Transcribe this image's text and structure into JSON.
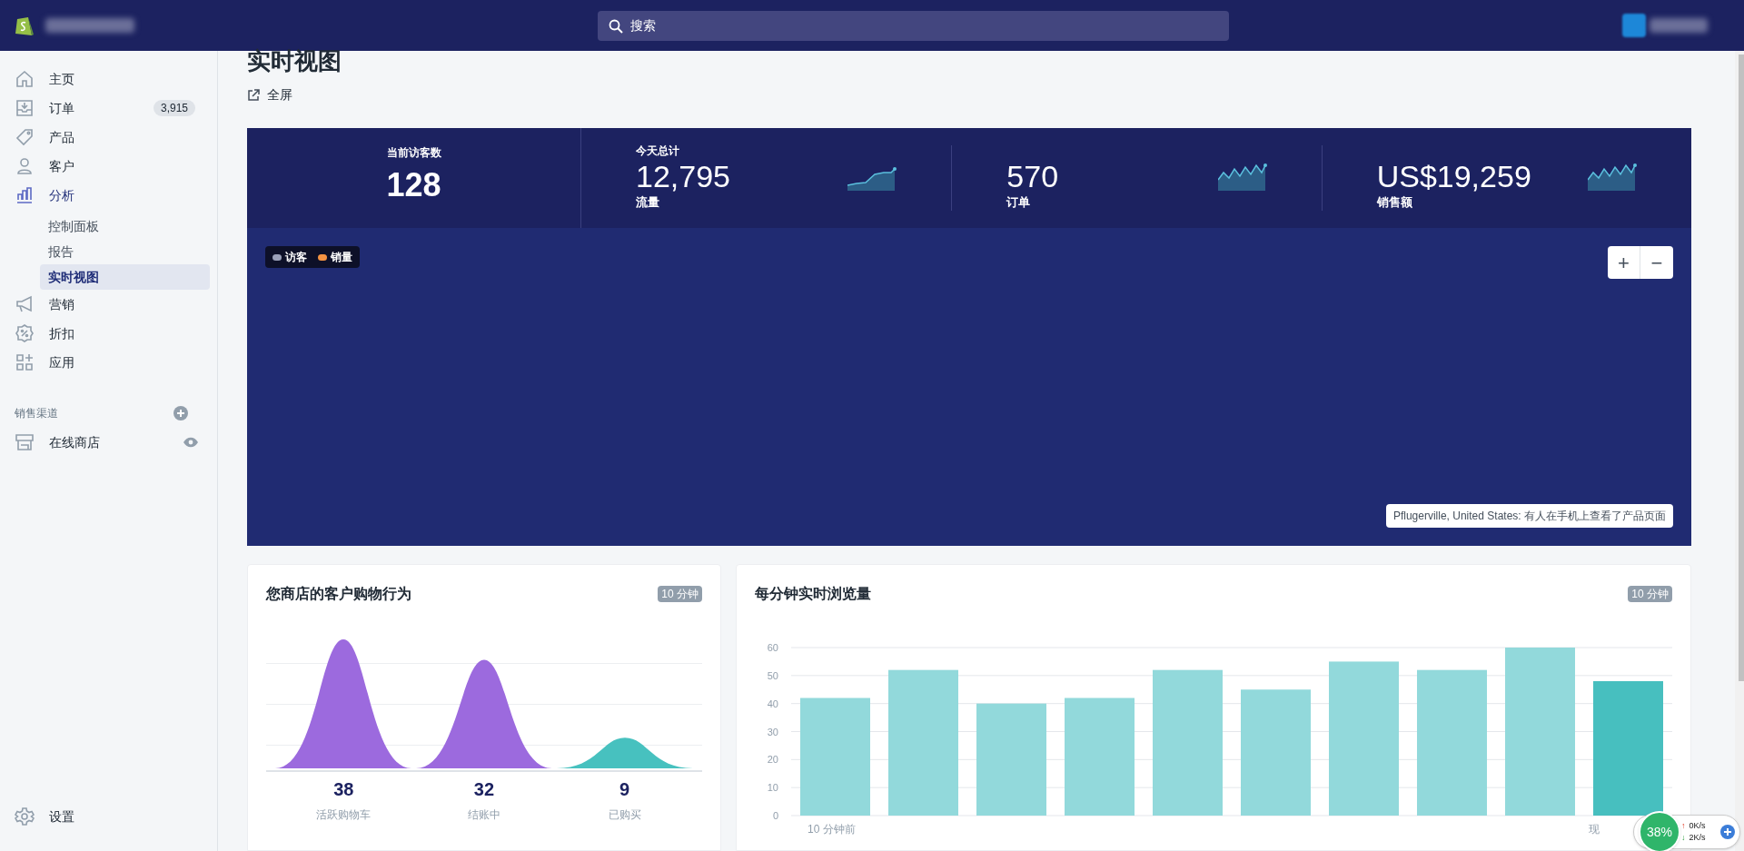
{
  "topbar": {
    "search": {
      "placeholder": "搜索"
    }
  },
  "sidebar": {
    "items": [
      {
        "kind": "home",
        "label": "主页",
        "selected": false
      },
      {
        "kind": "orders",
        "label": "订单",
        "badge": "3,915",
        "selected": false
      },
      {
        "kind": "products",
        "label": "产品",
        "selected": false
      },
      {
        "kind": "customers",
        "label": "客户",
        "selected": false
      },
      {
        "kind": "analytics",
        "label": "分析",
        "selected": true,
        "children": [
          {
            "label": "控制面板",
            "selected": false
          },
          {
            "label": "报告",
            "selected": false
          },
          {
            "label": "实时视图",
            "selected": true
          }
        ]
      },
      {
        "kind": "marketing",
        "label": "营销",
        "selected": false
      },
      {
        "kind": "discounts",
        "label": "折扣",
        "selected": false
      },
      {
        "kind": "apps",
        "label": "应用",
        "selected": false
      }
    ],
    "section_title": "销售渠道",
    "channels": [
      {
        "label": "在线商店"
      }
    ],
    "settings": "设置"
  },
  "page": {
    "title": "实时视图",
    "fullscreen": "全屏"
  },
  "stats": {
    "visitors": {
      "label": "当前访客数",
      "value": "128"
    },
    "group_title": "今天总计",
    "totals": [
      {
        "value": "12,795",
        "label": "流量"
      },
      {
        "value": "570",
        "label": "订单"
      },
      {
        "value": "US$19,259",
        "label": "销售额"
      }
    ]
  },
  "map": {
    "legend": [
      {
        "label": "访客",
        "color": "#9aa0b8"
      },
      {
        "label": "销量",
        "color": "#f49342"
      }
    ],
    "zoom_in": "+",
    "zoom_out": "−",
    "event": "Pflugerville, United States: 有人在手机上查看了产品页面"
  },
  "behavior": {
    "title": "您商店的客户购物行为",
    "badge": "10 分钟",
    "stages": [
      {
        "value": "38",
        "label": "活跃购物车",
        "color": "#9c6ade"
      },
      {
        "value": "32",
        "label": "结账中",
        "color": "#9c6ade"
      },
      {
        "value": "9",
        "label": "已购买",
        "color": "#47c1bf"
      }
    ]
  },
  "views": {
    "title": "每分钟实时浏览量",
    "badge": "10 分钟",
    "chart_data": {
      "type": "bar",
      "ylim": [
        0,
        60
      ],
      "yticks": [
        0,
        10,
        20,
        30,
        40,
        50,
        60
      ],
      "grid": true,
      "stacked": true,
      "series": [
        {
          "color": "#92d9db",
          "values": [
            42,
            52,
            40,
            42,
            52,
            45,
            55,
            52,
            60,
            null
          ]
        },
        {
          "color": "#47bfbf",
          "values": [
            null,
            null,
            null,
            null,
            null,
            null,
            null,
            null,
            null,
            48
          ]
        }
      ]
    },
    "x_labels": [
      "10 分钟前",
      "现"
    ]
  },
  "overlay": {
    "percent": "38%",
    "up_arrow": "↑",
    "up": "0K/s",
    "down_arrow": "↓",
    "down": "2K/s"
  }
}
